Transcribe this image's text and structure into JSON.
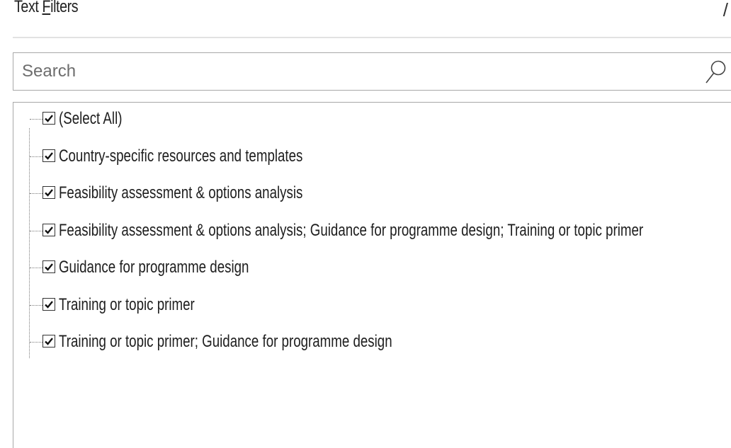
{
  "menu": {
    "text_filters_prefix": "Text ",
    "text_filters_accel": "F",
    "text_filters_suffix": "ilters",
    "submenu_arrow": "/"
  },
  "search": {
    "placeholder": "Search",
    "value": "",
    "icon": "search-icon"
  },
  "filter_list": {
    "items": [
      {
        "label": "(Select All)",
        "checked": true
      },
      {
        "label": "Country-specific resources and templates",
        "checked": true
      },
      {
        "label": "Feasibility assessment & options analysis",
        "checked": true
      },
      {
        "label": "Feasibility assessment & options analysis; Guidance for programme design; Training or topic primer",
        "checked": true
      },
      {
        "label": "Guidance for programme design",
        "checked": true
      },
      {
        "label": "Training or topic primer",
        "checked": true
      },
      {
        "label": "Training or topic primer; Guidance for programme design",
        "checked": true
      }
    ]
  },
  "colors": {
    "border": "#a8a8a8",
    "text": "#1e1e1e",
    "placeholder": "#6d6d6d"
  }
}
